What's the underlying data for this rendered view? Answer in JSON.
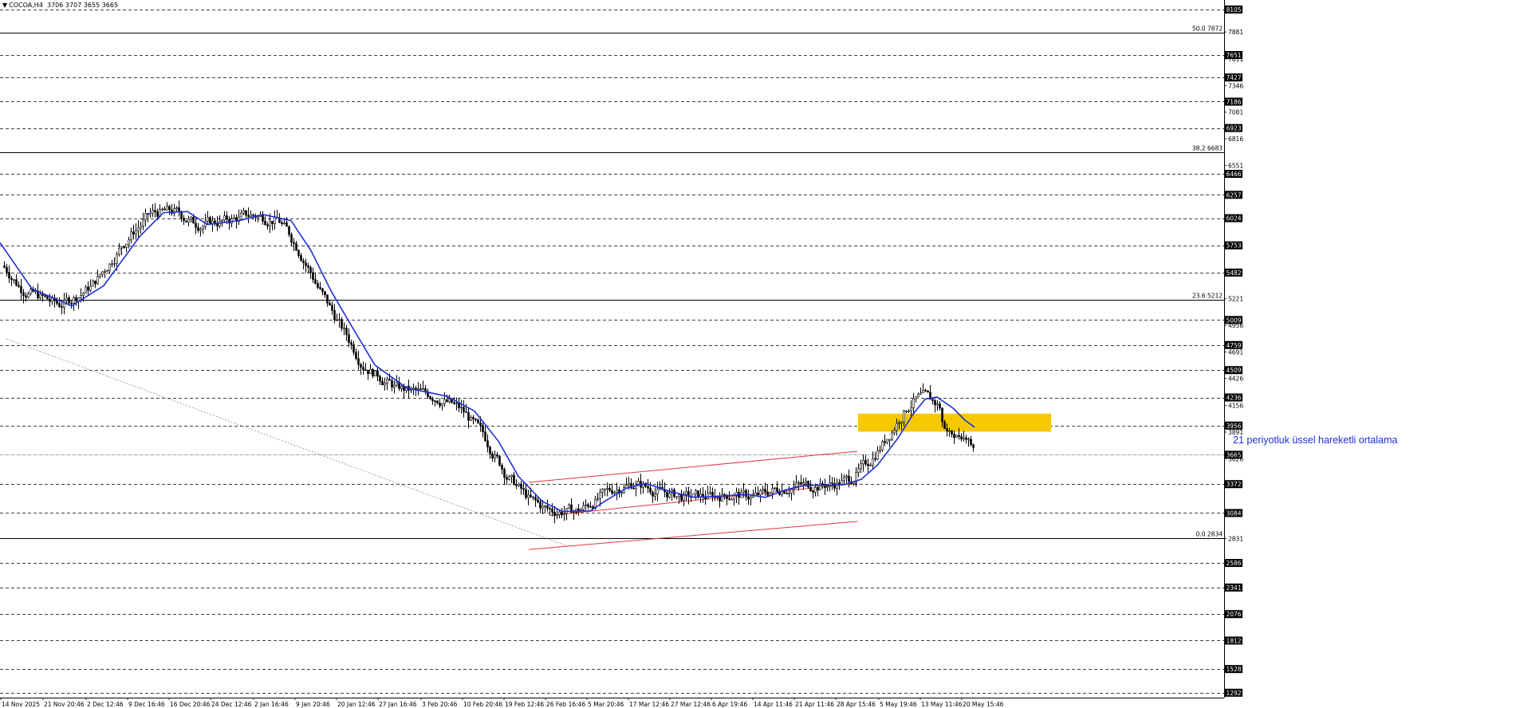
{
  "header": {
    "symbol": "COCOA,H4",
    "ohlc": "3706 3707 3655 3665",
    "icon": "triangle-down-icon"
  },
  "chart_data": {
    "type": "candlestick",
    "symbol": "COCOA",
    "timeframe": "H4",
    "ohlc": {
      "open": 3706,
      "high": 3707,
      "low": 3655,
      "close": 3665
    },
    "ylim": [
      1243,
      8144
    ],
    "grid": false,
    "y_tick_labels": [
      "8105",
      "7881",
      "7651",
      "7611",
      "7427",
      "7346",
      "7186",
      "7081",
      "6923",
      "6816",
      "6551",
      "6466",
      "6257",
      "6024",
      "5753",
      "5482",
      "5221",
      "5009",
      "4956",
      "4759",
      "4691",
      "4509",
      "4426",
      "4236",
      "4156",
      "3956",
      "3891",
      "3665",
      "3626",
      "3372",
      "3084",
      "2831",
      "2586",
      "2341",
      "2076",
      "1812",
      "1528",
      "1292"
    ],
    "x_tick_labels": [
      "14 Nov 2025",
      "21 Nov 20:46",
      "2 Dec 12:46",
      "9 Dec 16:46",
      "16 Dec 20:46",
      "24 Dec 12:46",
      "2 Jan 16:46",
      "9 Jan 20:46",
      "20 Jan 12:46",
      "27 Jan 16:46",
      "3 Feb 20:46",
      "10 Feb 20:46",
      "19 Feb 12:46",
      "26 Feb 16:46",
      "5 Mar 20:46",
      "17 Mar 12:46",
      "27 Mar 12:46",
      "6 Apr 19:46",
      "14 Apr 11:46",
      "21 Apr 11:46",
      "28 Apr 15:46",
      "5 May 19:46",
      "13 May 11:46",
      "20 May 15:46"
    ],
    "horizontal_levels": [
      8105,
      7651,
      7427,
      7186,
      6923,
      6466,
      6257,
      6024,
      5753,
      5482,
      5009,
      4759,
      4509,
      4236,
      3956,
      3665,
      3372,
      3084,
      2586,
      2341,
      2076,
      1812,
      1528,
      1292
    ],
    "fibonacci": [
      {
        "label": "50.0 7872",
        "ratio": "50.0",
        "price": 7872
      },
      {
        "label": "38.2 6683",
        "ratio": "38.2",
        "price": 6683
      },
      {
        "label": "23.6 5212",
        "ratio": "23.6",
        "price": 5212
      },
      {
        "label": "0.0 2834",
        "ratio": "0.0",
        "price": 2834
      }
    ],
    "current_price": 3665,
    "current_price_label": "3665",
    "series": [
      {
        "name": "21 periyotluk üssel hareketli ortalama",
        "type": "ema",
        "period": 21,
        "color": "#1f2fd6",
        "points": [
          [
            0,
            5780
          ],
          [
            40,
            5320
          ],
          [
            90,
            5150
          ],
          [
            130,
            5350
          ],
          [
            175,
            5840
          ],
          [
            205,
            6080
          ],
          [
            235,
            6090
          ],
          [
            260,
            5960
          ],
          [
            300,
            6000
          ],
          [
            330,
            6060
          ],
          [
            365,
            6000
          ],
          [
            390,
            5700
          ],
          [
            415,
            5300
          ],
          [
            440,
            4960
          ],
          [
            470,
            4560
          ],
          [
            510,
            4330
          ],
          [
            560,
            4250
          ],
          [
            595,
            4100
          ],
          [
            625,
            3800
          ],
          [
            650,
            3450
          ],
          [
            680,
            3200
          ],
          [
            705,
            3100
          ],
          [
            740,
            3105
          ],
          [
            760,
            3210
          ],
          [
            785,
            3330
          ],
          [
            810,
            3380
          ],
          [
            840,
            3300
          ],
          [
            870,
            3240
          ],
          [
            900,
            3250
          ],
          [
            935,
            3270
          ],
          [
            960,
            3240
          ],
          [
            985,
            3315
          ],
          [
            1010,
            3360
          ],
          [
            1040,
            3360
          ],
          [
            1060,
            3370
          ],
          [
            1080,
            3420
          ],
          [
            1100,
            3560
          ],
          [
            1125,
            3820
          ],
          [
            1145,
            4070
          ],
          [
            1160,
            4220
          ],
          [
            1175,
            4240
          ],
          [
            1195,
            4130
          ],
          [
            1210,
            4010
          ],
          [
            1222,
            3940
          ]
        ]
      }
    ],
    "candles_hint": {
      "start_price": 5550,
      "end_price": 3665
    },
    "channel_lines": [
      {
        "name": "upper",
        "from": [
          663,
          3390
        ],
        "to": [
          1075,
          3700
        ]
      },
      {
        "name": "middle",
        "from": [
          690,
          3060
        ],
        "to": [
          1075,
          3380
        ]
      },
      {
        "name": "lower",
        "from": [
          663,
          2720
        ],
        "to": [
          1075,
          3000
        ]
      }
    ],
    "trend_line_dotted": {
      "from": [
        8,
        4820
      ],
      "to": [
        713,
        2750
      ]
    },
    "highlight_zone": {
      "from_price": 3895,
      "to_price": 4075,
      "x_from": 1076,
      "x_to": 1318,
      "color": "#f5c800"
    },
    "annotation": "21 periyotluk üssel hareketli ortalama"
  },
  "colors": {
    "background": "#ffffff",
    "candle": "#000000",
    "ema": "#1f2fd6",
    "channel": "#e0383b",
    "zone": "#f5c800",
    "grid_dash": "#000000"
  }
}
